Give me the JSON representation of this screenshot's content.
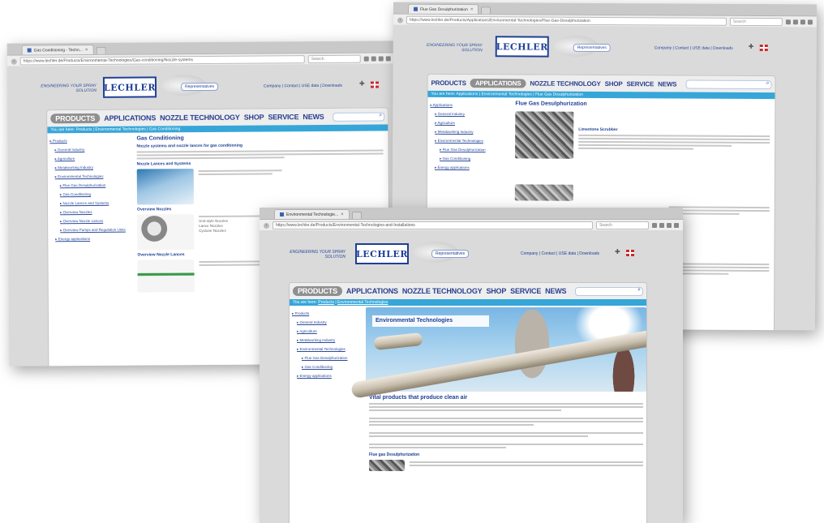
{
  "site": {
    "slogan": "ENGINEERING YOUR SPRAY SOLUTION",
    "logo": "LECHLER",
    "representatives_button": "Representatives",
    "top_links": "Company | Contact | USE data | Downloads",
    "nav": {
      "products": "PRODUCTS",
      "applications": "APPLICATIONS",
      "nozzle_technology": "NOZZLE TECHNOLOGY",
      "shop": "SHOP",
      "service": "SERVICE",
      "news": "NEWS"
    }
  },
  "left_window": {
    "tab_title": "Gas Conditioning - Techn...",
    "url": "https://www.lechler.de/Products/Environmental-Technologies/Gas-conditioning/Nozzle-systems",
    "search_placeholder": "Search",
    "breadcrumb": "You are here: Products | Environmental Technologies | Gas Conditioning",
    "sidebar": [
      {
        "label": "Products",
        "level": 0
      },
      {
        "label": "General Industry",
        "level": 1
      },
      {
        "label": "Agriculture",
        "level": 1
      },
      {
        "label": "Metalworking Industry",
        "level": 1
      },
      {
        "label": "Environmental Technologies",
        "level": 1
      },
      {
        "label": "Flue Gas Desulphurization",
        "level": 2
      },
      {
        "label": "Gas Conditioning",
        "level": 2
      },
      {
        "label": "Nozzle Lances and Systems",
        "level": 2
      },
      {
        "label": "Overview Nozzles",
        "level": 2
      },
      {
        "label": "Overview Nozzle Lances",
        "level": 2
      },
      {
        "label": "Overview Pumps and Regulation Units",
        "level": 2
      },
      {
        "label": "Energy applications",
        "level": 1
      }
    ],
    "title": "Gas Conditioning",
    "subtitle": "Nozzle systems and nozzle lances for gas conditioning",
    "section1": "Nozzle Lances and Systems",
    "section2": "Overview Nozzles",
    "section2_items": [
      "Unit-style Nozzles",
      "Lance Nozzles",
      "Cyclone Nozzles"
    ],
    "section3": "Overview Nozzle Lances"
  },
  "right_window": {
    "tab_title": "Flue Gas Desulphurization",
    "url": "https://www.lechler.de/Products/Applications/Environmental-Technologies/Flue-Gas-Desulphurization",
    "search_placeholder": "Search",
    "breadcrumb": "You are here: Applications | Environmental Technologies | Flue Gas Desulphurization",
    "sidebar": [
      {
        "label": "Applications",
        "level": 0
      },
      {
        "label": "General Industry",
        "level": 1
      },
      {
        "label": "Agriculture",
        "level": 1
      },
      {
        "label": "Metalworking Industry",
        "level": 1
      },
      {
        "label": "Environmental Technologies",
        "level": 1
      },
      {
        "label": "Flue Gas Desulphurization",
        "level": 2
      },
      {
        "label": "Gas Conditioning",
        "level": 2
      },
      {
        "label": "Energy applications",
        "level": 1
      }
    ],
    "title": "Flue Gas Desulphurization",
    "section1": "Limestone Scrubber"
  },
  "front_window": {
    "tab_title": "Environmental Technologie...",
    "url": "https://www.lechler.de/Products/Environmental-Technologies-and-Installations",
    "search_placeholder": "Search",
    "breadcrumb_prefix": "You are here:",
    "breadcrumb_links": [
      "Products",
      "Environmental Technologies"
    ],
    "sidebar": [
      {
        "label": "Products",
        "level": 0
      },
      {
        "label": "General Industry",
        "level": 1
      },
      {
        "label": "Agriculture",
        "level": 1
      },
      {
        "label": "Metalworking Industry",
        "level": 1
      },
      {
        "label": "Environmental Technologies",
        "level": 1
      },
      {
        "label": "Flue Gas Desulphurization",
        "level": 2
      },
      {
        "label": "Gas Conditioning",
        "level": 2
      },
      {
        "label": "Energy applications",
        "level": 1
      }
    ],
    "hero_title": "Environmental Technologies",
    "headline": "Vital products that produce clean air",
    "section1": "Flue gas Desulphurization"
  },
  "colors": {
    "brand_blue": "#1e3f95",
    "breadcrumb_blue": "#36a6d8",
    "active_nav": "#8f8f8f"
  }
}
